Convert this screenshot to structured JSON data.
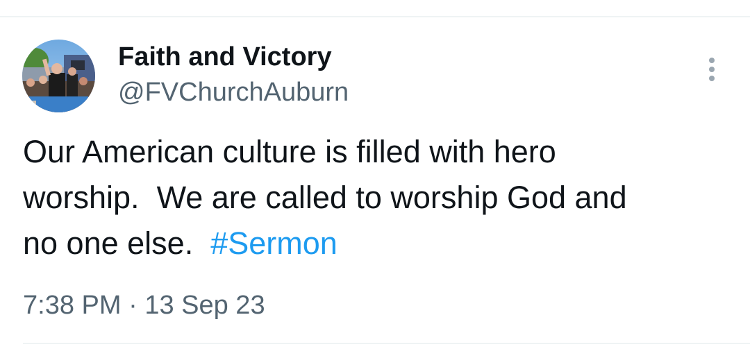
{
  "tweet": {
    "author": {
      "display_name": "Faith and Victory",
      "handle": "@FVChurchAuburn",
      "avatar_icon": "profile-photo"
    },
    "text_line_1": "Our American culture is filled with hero",
    "text_line_2": "worship.  We are called to worship God and",
    "text_line_3_prefix": "no one else.  ",
    "hashtag": "#Sermon",
    "time": "7:38 PM",
    "separator": "·",
    "date": "13 Sep 23",
    "more_icon": "more-vertical-icon"
  },
  "colors": {
    "text": "#0f1419",
    "secondary": "#536471",
    "link": "#1d9bf0",
    "divider": "#eff3f4"
  }
}
